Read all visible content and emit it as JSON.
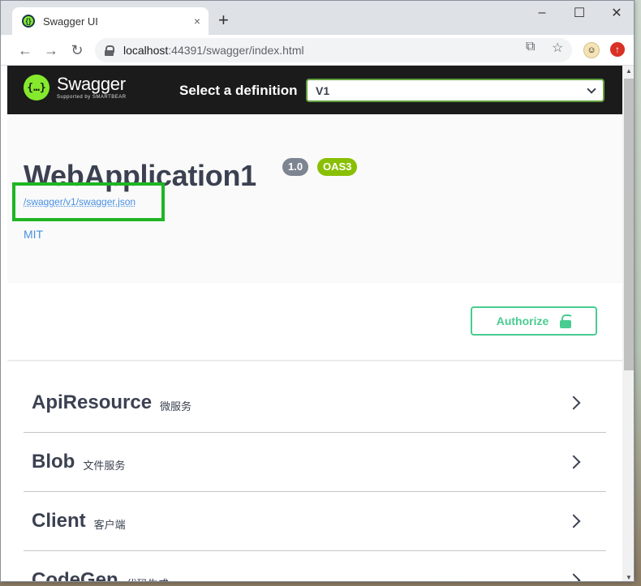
{
  "browser": {
    "tab_title": "Swagger UI",
    "tab_close": "×",
    "new_tab": "+",
    "window_controls": [
      "–",
      "☐",
      "✕"
    ],
    "url_host": "localhost",
    "url_rest": ":44391/swagger/index.html",
    "nav": {
      "back": "←",
      "forward": "→",
      "reload": "↻"
    },
    "translate_icon": "⧉",
    "star_icon": "☆",
    "extension_icon": "↑"
  },
  "swagger": {
    "logo_mark": "{…}",
    "logo_name": "Swagger",
    "logo_sub": "Supported by SMARTBEAR",
    "select_label": "Select a definition",
    "selected_definition": "V1",
    "api_title": "WebApplication1",
    "version_badge": "1.0",
    "oas_badge": "OAS3",
    "spec_url": "/swagger/v1/swagger.json",
    "license": "MIT",
    "authorize_label": "Authorize",
    "brand_color": "#85ea2d",
    "accent_color": "#49cc90",
    "highlight_color": "#1fb524"
  },
  "tags": [
    {
      "name": "ApiResource",
      "description": "微服务"
    },
    {
      "name": "Blob",
      "description": "文件服务"
    },
    {
      "name": "Client",
      "description": "客户端"
    },
    {
      "name": "CodeGen",
      "description": "代码生成"
    }
  ]
}
